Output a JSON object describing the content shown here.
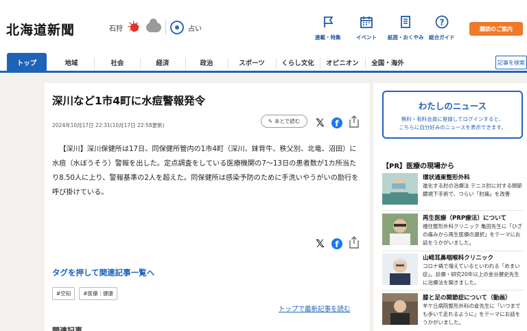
{
  "header": {
    "logo": "北海道新聞",
    "weather": {
      "location": "石狩",
      "fortune_label": "占い"
    },
    "nav_icons": [
      {
        "label": "連載・特集",
        "icon": "flag-icon"
      },
      {
        "label": "イベント",
        "icon": "calendar-icon"
      },
      {
        "label": "紙面・おくやみ",
        "icon": "newspaper-icon"
      },
      {
        "label": "総合ガイド",
        "icon": "help-icon"
      }
    ],
    "subscribe_label": "購読のご案内"
  },
  "nav": {
    "items": [
      "トップ",
      "地域",
      "社会",
      "経済",
      "政治",
      "スポーツ",
      "くらし文化",
      "オピニオン",
      "全国・海外"
    ],
    "active": "トップ",
    "search_label": "記事を検索"
  },
  "article": {
    "title": "深川など1市4町に水痘警報発令",
    "date": "2024年10月17日 22:31(10月17日 22:58更新)",
    "read_later_label": "あとで読む",
    "body": "【深川】深川保健所は17日、同保健所管内の1市4町（深川、妹背牛、秩父別、北竜、沼田）に水痘（水ぼうそう）警報を出した。定点調査をしている医療機関の7～13日の患者数が1カ所当たり8.50人に上り、警報基準の2人を超えた。同保健所は感染予防のために手洗いやうがいの励行を呼び掛けている。",
    "tag_heading": "タグを押して関連記事一覧へ",
    "tags": [
      "#空知",
      "#医療｜健康"
    ],
    "top_link": "トップで最新記事を読む",
    "cut_text": "関連記事"
  },
  "sidebar": {
    "mynews": {
      "title": "わたしのニュース",
      "line1": "無料・有料会員に登録してログインすると、",
      "line2": "こちらに自分好みのニュースを表示できます。"
    },
    "pr_heading": "【PR】医療の現場から",
    "pr_items": [
      {
        "title": "環状通東整形外科",
        "desc": "進化する肘の治療法 テニス肘に対する関節鏡視下手術で、つらい「肘痛」を改善"
      },
      {
        "title": "再生医療（PRP療法）について",
        "desc": "福住整形外科クリニック 亀田先生に「ひざの痛みから再生医療の選択」をテーマにお話をうかがいました。"
      },
      {
        "title": "山﨑耳鼻咽喉科クリニック",
        "desc": "コロナ禍で増えているといわれる「めまい症」。診療・研究20年以上の金谷健史先生に治療法を聞きました。"
      },
      {
        "title": "膝と足の関節症について（動画）",
        "desc": "羊ケ丘病院整形外科の倉先生に「いつまでも歩いて走れるように」をテーマにお話をうかがいました。"
      }
    ]
  },
  "colors": {
    "brand_blue": "#1f63b8",
    "accent_orange": "#ef7a2a",
    "sun_red": "#e2322a"
  }
}
